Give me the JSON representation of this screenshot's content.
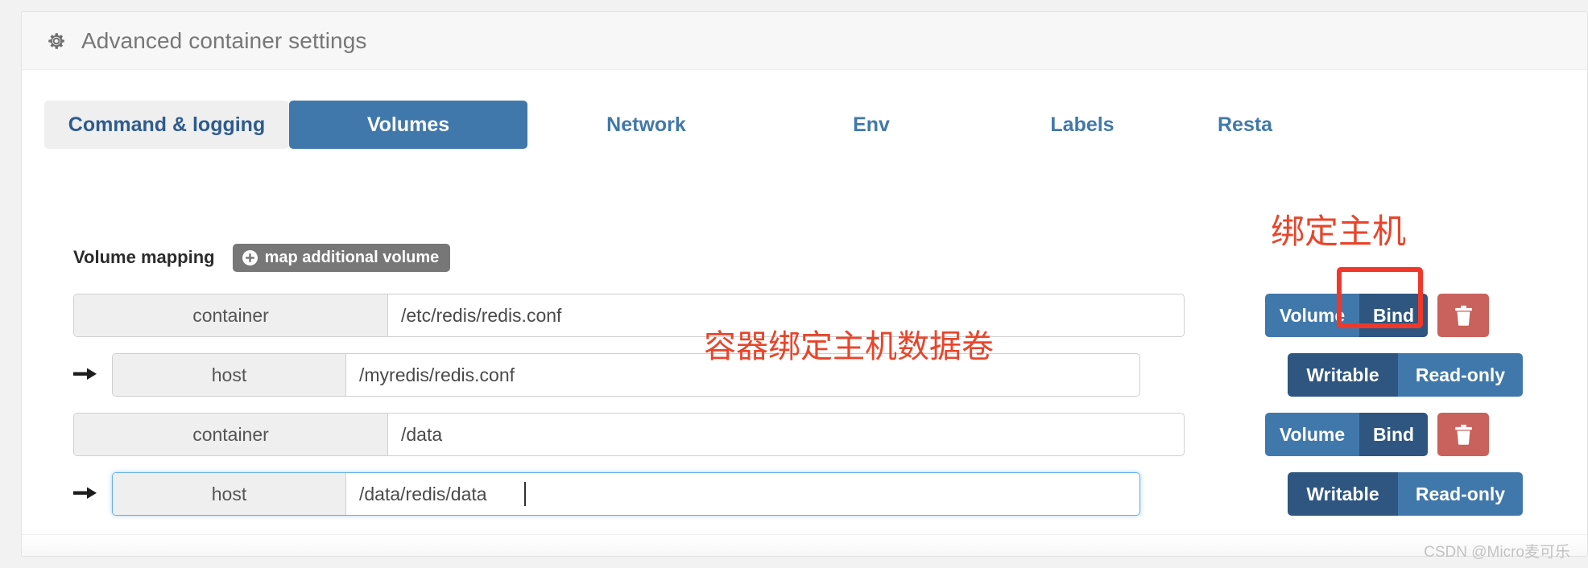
{
  "panel": {
    "title": "Advanced container settings",
    "gear_icon": "gear-icon"
  },
  "tabs": [
    {
      "label": "Command & logging",
      "state": "idle-filled"
    },
    {
      "label": "Volumes",
      "state": "active"
    },
    {
      "label": "Network",
      "state": "plain"
    },
    {
      "label": "Env",
      "state": "plain"
    },
    {
      "label": "Labels",
      "state": "plain"
    },
    {
      "label": "Resta",
      "state": "plain"
    }
  ],
  "volume_mapping": {
    "label": "Volume mapping",
    "add_button": "map additional volume",
    "add_button_icon": "plus-circle-icon"
  },
  "rows": [
    {
      "addon": "container",
      "value": "/etc/redis/redis.conf",
      "placeholder": "",
      "type_toggle": {
        "option_a": "Volume",
        "option_b": "Bind",
        "selected": "Bind"
      },
      "delete_icon": "trash-icon",
      "focused": false
    },
    {
      "addon": "host",
      "value": "/myredis/redis.conf",
      "placeholder": "",
      "access_toggle": {
        "option_a": "Writable",
        "option_b": "Read-only",
        "selected": "Writable"
      },
      "focused": false
    },
    {
      "addon": "container",
      "value": "/data",
      "placeholder": "",
      "type_toggle": {
        "option_a": "Volume",
        "option_b": "Bind",
        "selected": "Bind"
      },
      "delete_icon": "trash-icon",
      "focused": false
    },
    {
      "addon": "host",
      "value": "/data/redis/data",
      "placeholder": "",
      "access_toggle": {
        "option_a": "Writable",
        "option_b": "Read-only",
        "selected": "Writable"
      },
      "focused": true
    }
  ],
  "annotations": {
    "bind_host": "绑定主机",
    "container_bind_host_volume": "容器绑定主机数据卷"
  },
  "watermark": "CSDN @Micro麦可乐",
  "colors": {
    "accent_blue": "#4178ab",
    "accent_blue_dark": "#2e5680",
    "danger_red": "#c9615c",
    "annotation_red": "#e8452b",
    "highlight_red": "#f0382a",
    "addon_grey": "#efefef",
    "add_button_grey": "#777777"
  }
}
